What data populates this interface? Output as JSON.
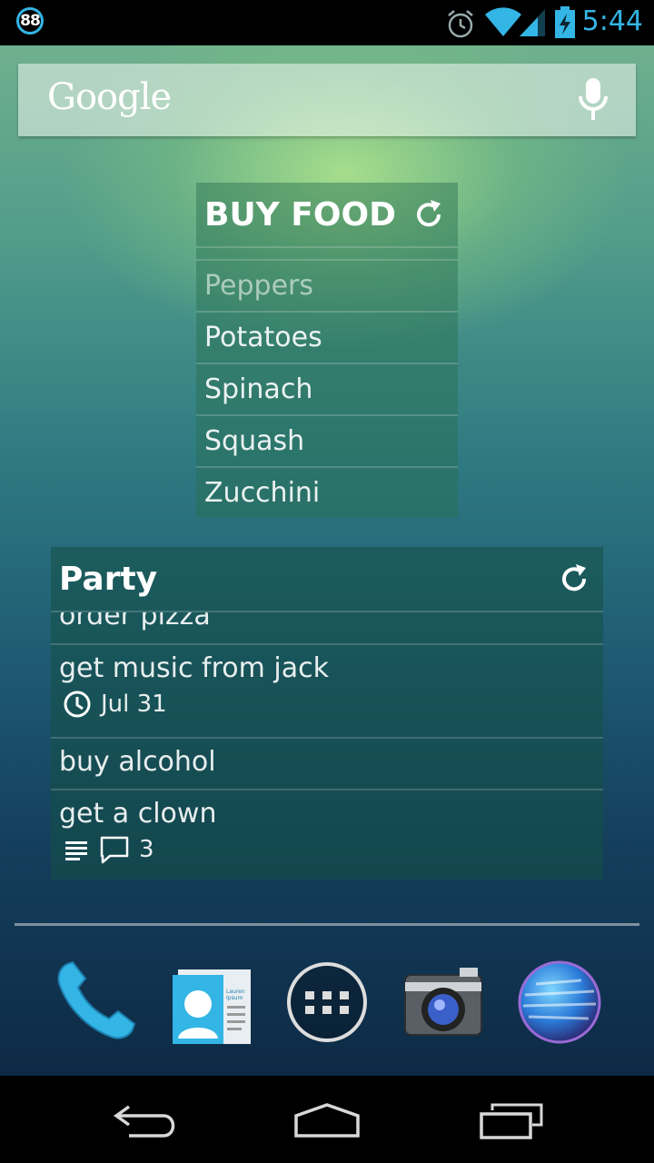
{
  "status_bar": {
    "notification_badge": "88",
    "time": "5:44",
    "icons": [
      "alarm-icon",
      "wifi-icon",
      "signal-icon",
      "battery-charging-icon"
    ],
    "accent_color": "#33b5e5"
  },
  "search": {
    "logo_text": "Google",
    "icon": "mic-icon"
  },
  "food_widget": {
    "title": "BUY FOOD",
    "items": [
      "Peppers",
      "Potatoes",
      "Spinach",
      "Squash",
      "Zucchini"
    ]
  },
  "party_widget": {
    "title": "Party",
    "items": [
      {
        "label": "order pizza"
      },
      {
        "label": "get music from jack",
        "due": "Jul 31"
      },
      {
        "label": "buy alcohol"
      },
      {
        "label": "get a clown",
        "comments": "3"
      }
    ]
  },
  "dock": {
    "apps": [
      "phone-icon",
      "contacts-icon",
      "app-drawer-icon",
      "camera-icon",
      "browser-icon"
    ],
    "contact_card_text": "Lauren Ipsum"
  },
  "nav": [
    "back-icon",
    "home-icon",
    "recents-icon"
  ]
}
